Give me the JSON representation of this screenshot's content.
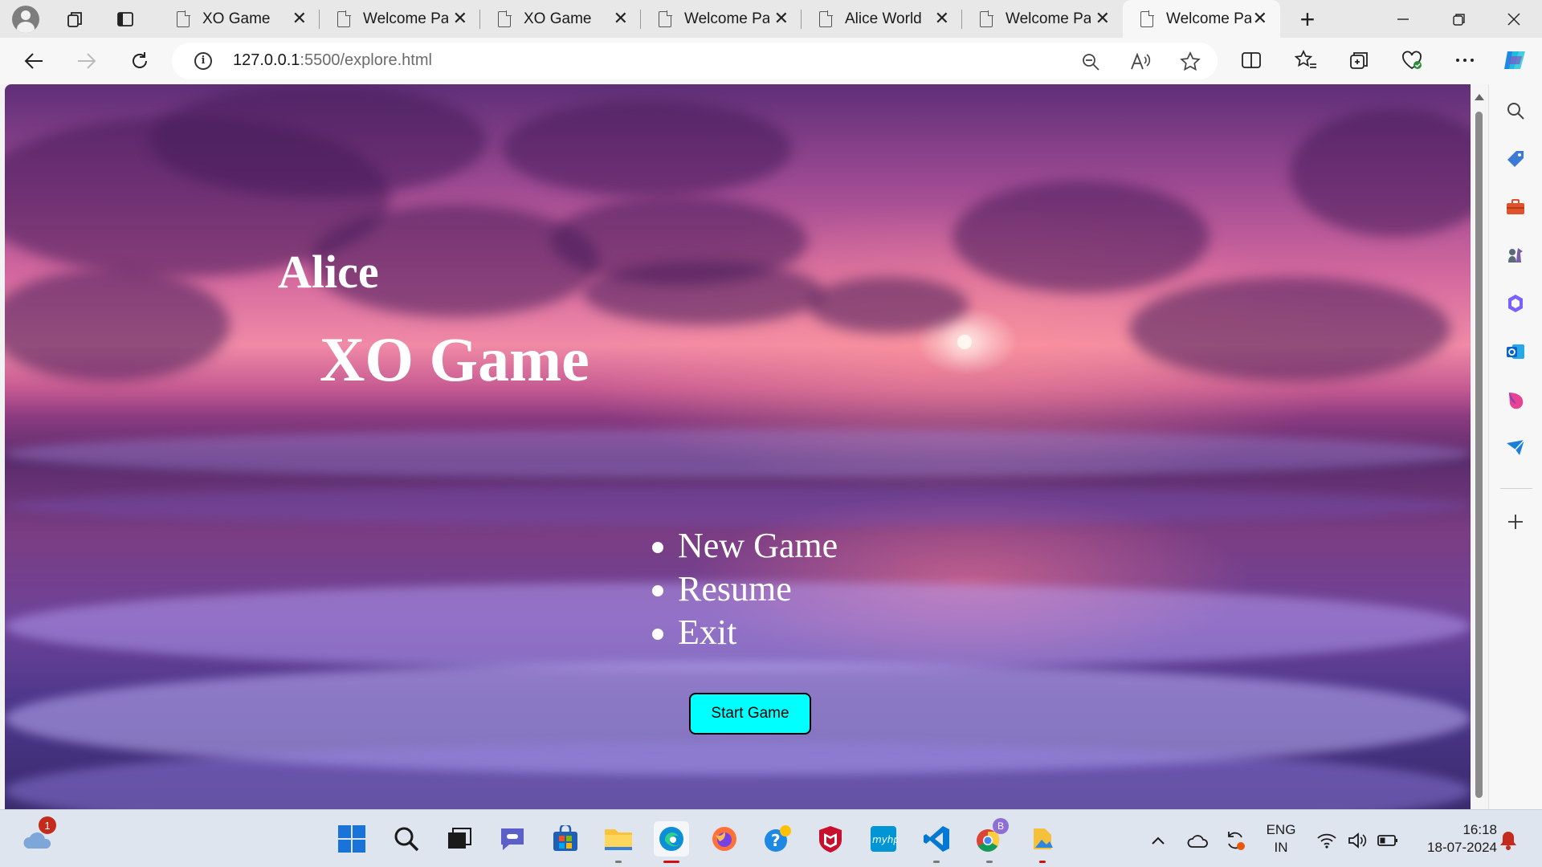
{
  "browser": {
    "tabs": [
      {
        "title": "XO Game"
      },
      {
        "title": "Welcome Page"
      },
      {
        "title": "XO Game"
      },
      {
        "title": "Welcome Page"
      },
      {
        "title": "Alice World"
      },
      {
        "title": "Welcome Page"
      },
      {
        "title": "Welcome Page",
        "active": true
      }
    ],
    "url_host": "127.0.0.1",
    "url_rest": ":5500/explore.html"
  },
  "page": {
    "brand": "Alice",
    "title": "XO Game",
    "menu": [
      "New Game",
      "Resume",
      "Exit"
    ],
    "start_button": "Start Game",
    "button_color": "#00ffff"
  },
  "sidebar": {
    "icons": [
      "search-icon",
      "tag-icon",
      "toolbox-icon",
      "chess-icon",
      "copilot-icon",
      "outlook-icon",
      "drop-icon",
      "send-icon",
      "add-icon"
    ]
  },
  "taskbar": {
    "weather_badge": "1",
    "chrome_badge": "B",
    "lang_primary": "ENG",
    "lang_secondary": "IN",
    "time": "16:18",
    "date": "18-07-2024"
  }
}
